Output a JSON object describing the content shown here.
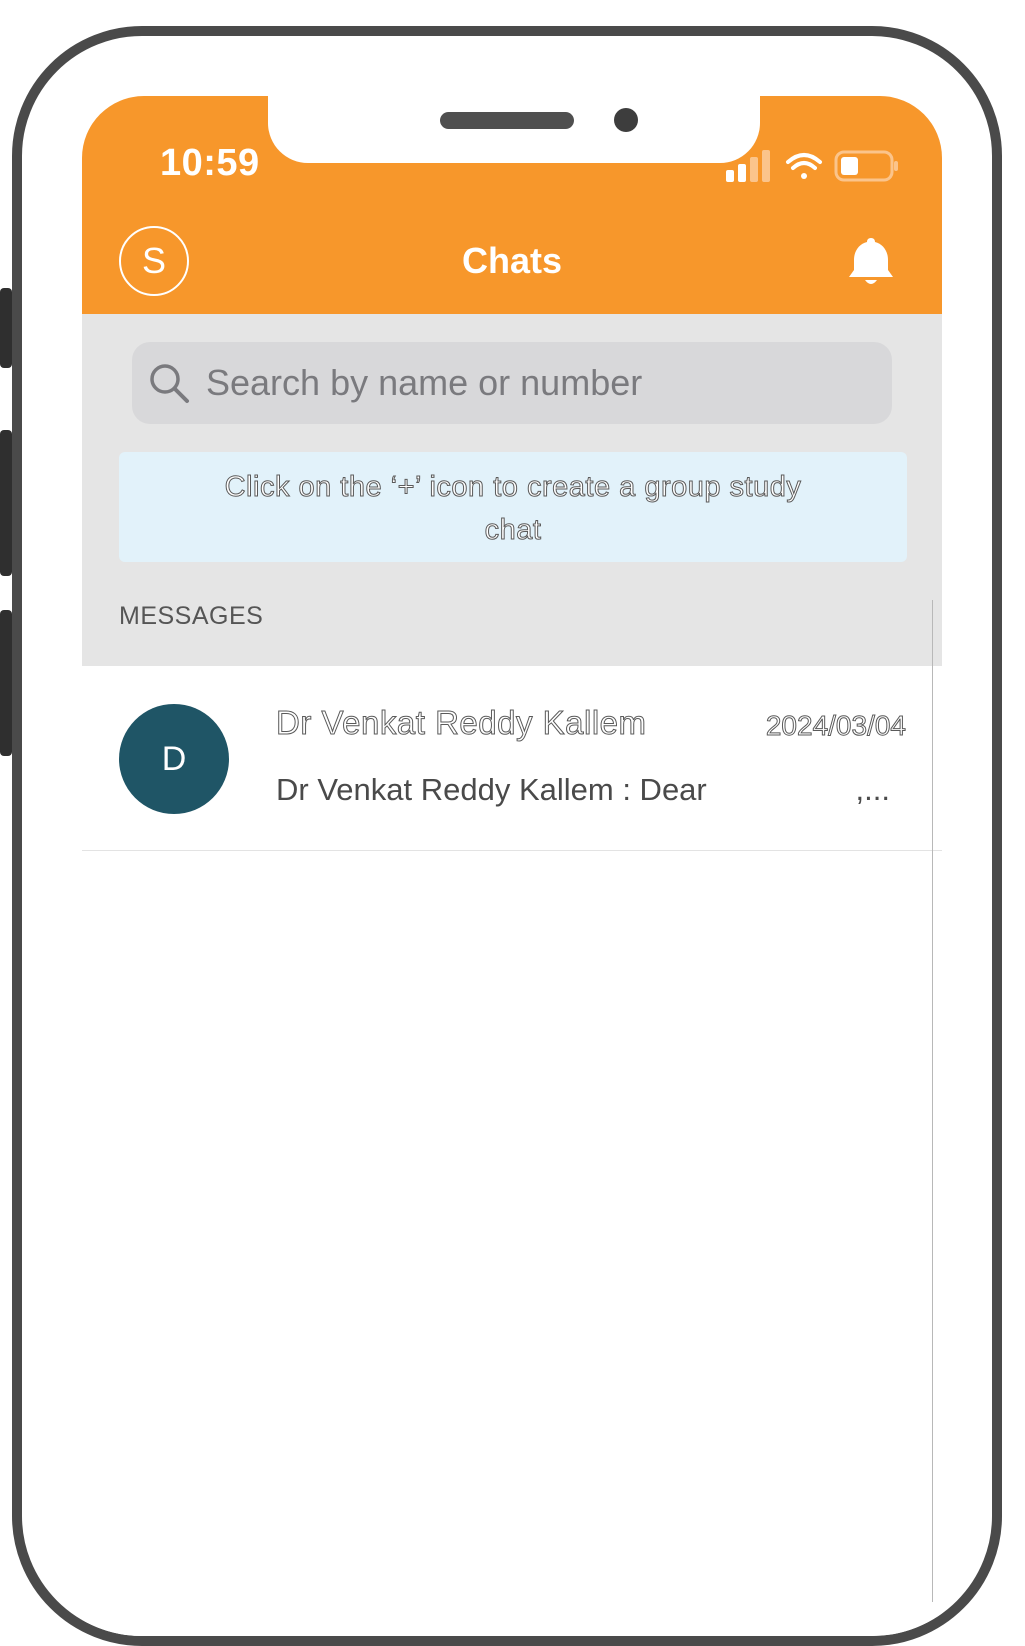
{
  "status_bar": {
    "time": "10:59"
  },
  "header": {
    "avatar_initial": "S",
    "title": "Chats"
  },
  "search": {
    "placeholder": "Search by name or number"
  },
  "tip_banner": {
    "text": "Click on the ‘+’ icon to create a group study chat"
  },
  "messages_section": {
    "label": "MESSAGES"
  },
  "chats": [
    {
      "avatar_initial": "D",
      "name": "Dr Venkat Reddy Kallem",
      "date": "2024/03/04",
      "preview": "Dr Venkat Reddy Kallem : Dear",
      "preview_suffix": ",..."
    }
  ],
  "colors": {
    "brand_orange": "#f7972b",
    "avatar_teal": "#1f5566",
    "tip_bg": "#e2f2fa",
    "section_bg": "#e5e5e5"
  },
  "icons": [
    "signal-icon",
    "wifi-icon",
    "battery-icon",
    "bell-icon",
    "search-icon"
  ]
}
